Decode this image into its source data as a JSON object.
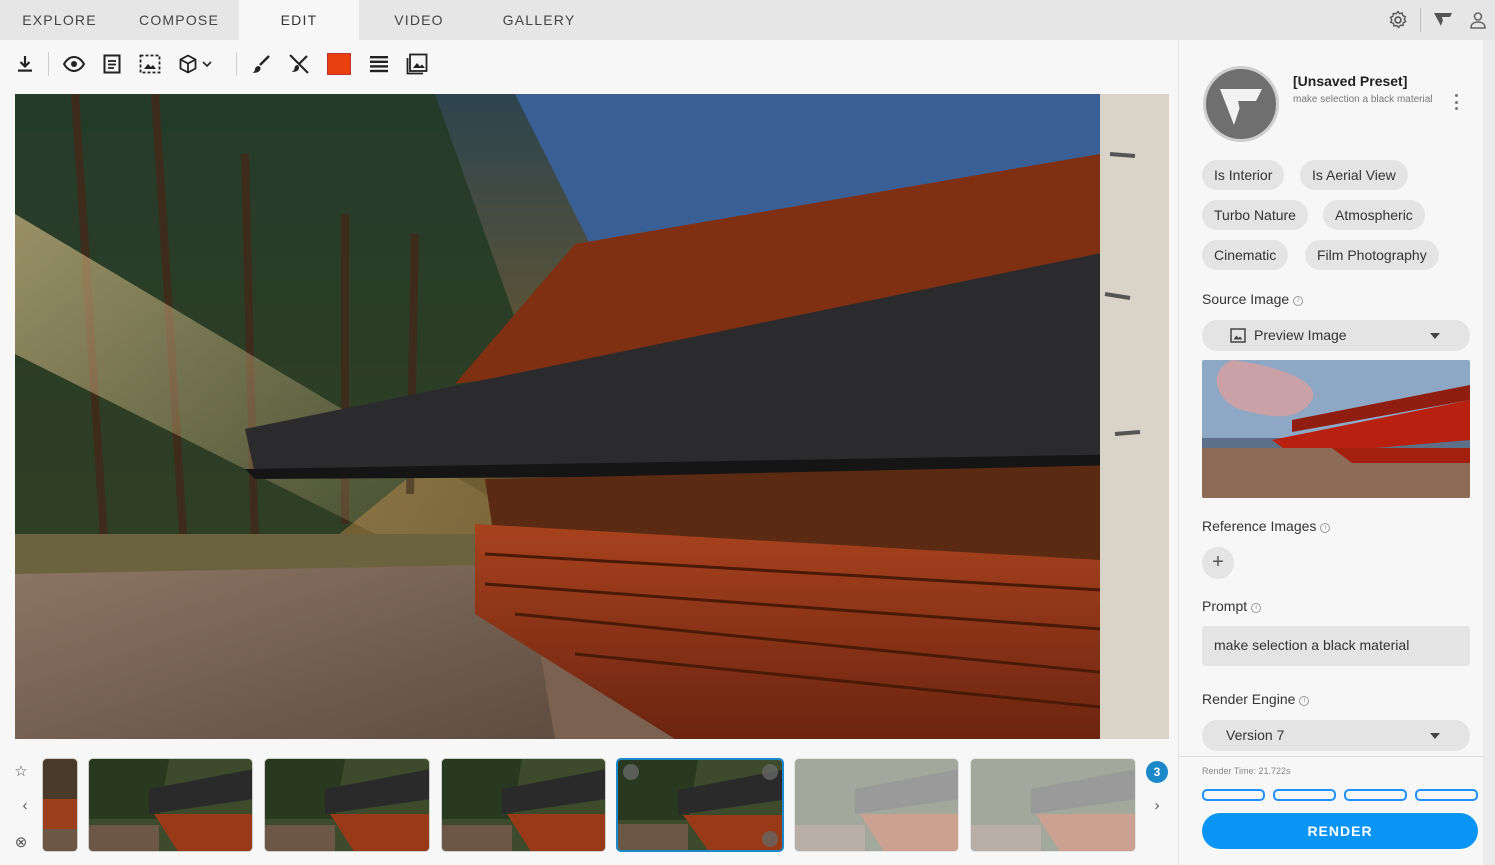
{
  "nav": {
    "tabs": [
      {
        "label": "EXPLORE"
      },
      {
        "label": "COMPOSE"
      },
      {
        "label": "EDIT"
      },
      {
        "label": "VIDEO"
      },
      {
        "label": "GALLERY"
      }
    ],
    "active_tab": "EDIT",
    "icons": [
      "gear-icon",
      "logo-icon",
      "user-icon"
    ]
  },
  "toolbar": {
    "tools": [
      "download-icon",
      "eye-icon",
      "document-icon",
      "selection-image-icon",
      "cube-icon",
      "chevron-down-icon",
      "brush-icon",
      "no-brush-icon",
      "color-swatch",
      "layers-icon",
      "image-icon"
    ],
    "swatch_color": "#e8400f"
  },
  "filmstrip": {
    "badge_count": "3",
    "thumbnail_count": 7,
    "selected_index": 4
  },
  "panel": {
    "preset": {
      "title": "[Unsaved Preset]",
      "subtitle": "make selection a black material"
    },
    "chips": [
      "Is Interior",
      "Is Aerial View",
      "Turbo Nature",
      "Atmospheric",
      "Cinematic",
      "Film Photography"
    ],
    "source_image": {
      "label": "Source Image",
      "selected": "Preview Image"
    },
    "reference_images": {
      "label": "Reference Images",
      "add": "+"
    },
    "prompt": {
      "label": "Prompt",
      "value": "make selection a black material"
    },
    "render_engine": {
      "label": "Render Engine",
      "selected": "Version 7"
    },
    "render_time": "Render Time: 21.722s",
    "render_button": "RENDER",
    "accent": "#0a95f5"
  }
}
